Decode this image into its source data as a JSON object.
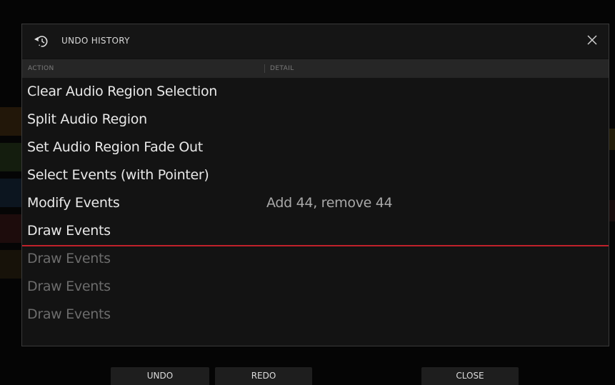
{
  "dialog": {
    "title": "UNDO HISTORY",
    "title_icon": "undo-history-icon",
    "close_icon": "close-icon"
  },
  "columns": {
    "action": "ACTION",
    "detail": "DETAIL"
  },
  "history": [
    {
      "action": "Clear Audio Region Selection",
      "detail": "",
      "state": "done"
    },
    {
      "action": "Split Audio Region",
      "detail": "",
      "state": "done"
    },
    {
      "action": "Set Audio Region Fade Out",
      "detail": "",
      "state": "done"
    },
    {
      "action": "Select Events (with Pointer)",
      "detail": "",
      "state": "done"
    },
    {
      "action": "Modify Events",
      "detail": "Add 44, remove 44",
      "state": "done"
    },
    {
      "action": "Draw Events",
      "detail": "",
      "state": "current"
    },
    {
      "action": "Draw Events",
      "detail": "",
      "state": "undone"
    },
    {
      "action": "Draw Events",
      "detail": "",
      "state": "undone"
    },
    {
      "action": "Draw Events",
      "detail": "",
      "state": "undone"
    }
  ],
  "buttons": {
    "undo": "UNDO",
    "redo": "REDO",
    "close": "CLOSE"
  },
  "colors": {
    "current_marker": "#c0212b",
    "text_active": "#e8e8e8",
    "text_undone": "#6c6c6c"
  }
}
